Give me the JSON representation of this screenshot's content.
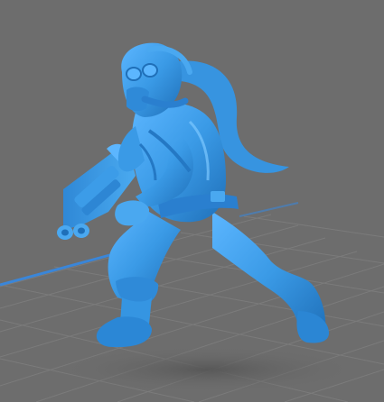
{
  "scene": {
    "background_color": "#6d6d6d",
    "grid_line_color": "#7a7a7a",
    "grid_major_color": "#2f7fd8",
    "model_color": "#3a9ae6",
    "model_shadow_color": "#1f6fb8",
    "model_highlight_color": "#6cc0ff",
    "floor_shadow_color": "#5a5a5a",
    "subject": "3d-printable-miniature"
  }
}
